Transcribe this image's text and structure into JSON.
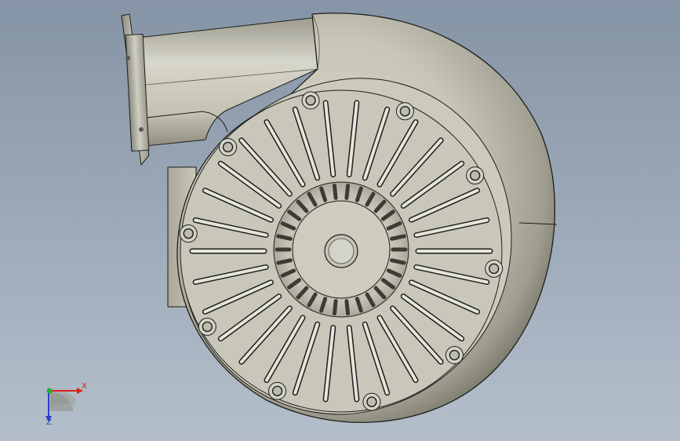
{
  "viewport": {
    "background_top": "#8594a6",
    "background_bottom": "#b4bfcb"
  },
  "model": {
    "name": "centrifugal-blower",
    "body_color": "#c9c8bb",
    "edge_color": "#1e1e1a",
    "hub_holes": 30,
    "vent_slots": 30,
    "bolt_holes": 10
  },
  "triad": {
    "x_label": "X",
    "z_label": "Z",
    "x_color": "#e0201a",
    "y_color": "#22b02a",
    "z_color": "#2a3fc8"
  }
}
